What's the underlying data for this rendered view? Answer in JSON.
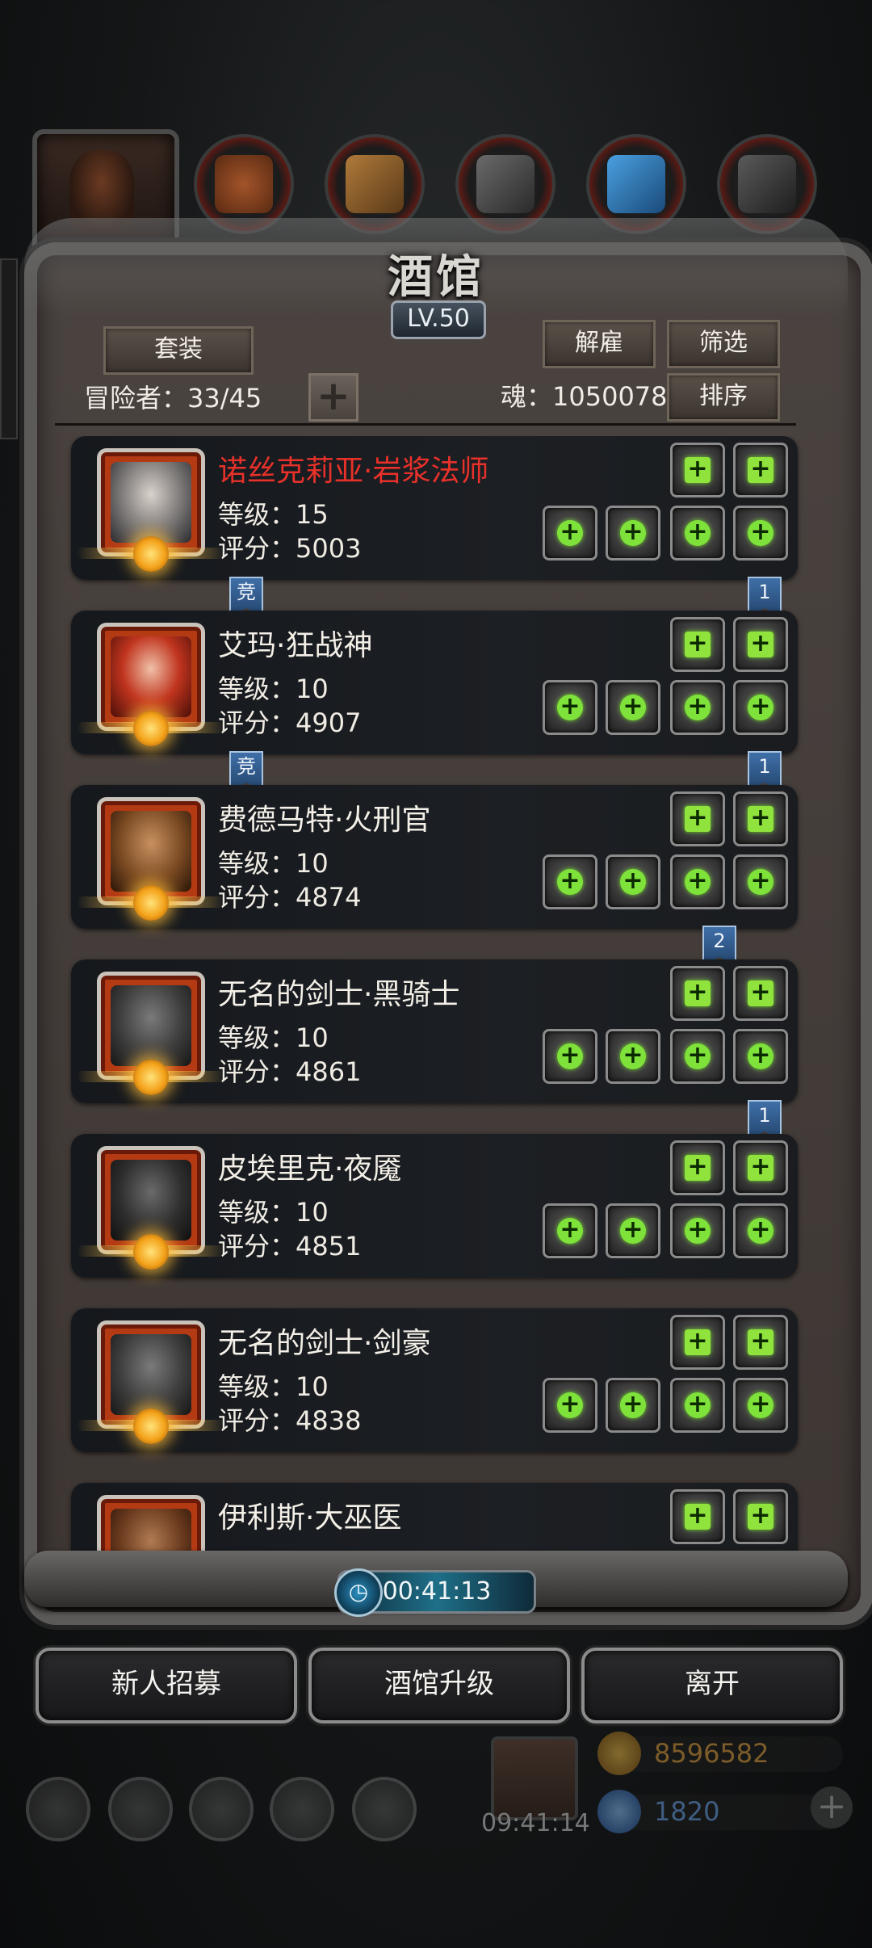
{
  "window": {
    "title": "酒馆",
    "level_badge": "LV.50"
  },
  "header": {
    "outfit_button": "套装",
    "dismiss_button": "解雇",
    "filter_button": "筛选",
    "sort_button": "排序",
    "adventurers_label": "冒险者：33/45",
    "add_capacity": "+",
    "soul_label": "魂：1050078"
  },
  "slot_icons": [
    "weapon-slot",
    "armor-slot",
    "accessory-slot",
    "ring-slot",
    "skill-slot-1",
    "skill-slot-2"
  ],
  "heroes": [
    {
      "name": "诺丝克莉亚·岩浆法师",
      "level": "等级：15",
      "score": "评分：5003",
      "name_color": "#e8312a",
      "badge_left": "竞",
      "badge_right": "1",
      "badge_left_shown": true,
      "badge_right_shown": true
    },
    {
      "name": "艾玛·狂战神",
      "level": "等级：10",
      "score": "评分：4907",
      "name_color": "#f4f0e8",
      "badge_left": "竞",
      "badge_right": "1",
      "badge_left_shown": true,
      "badge_right_shown": true
    },
    {
      "name": "费德马特·火刑官",
      "level": "等级：10",
      "score": "评分：4874",
      "name_color": "#f4f0e8",
      "badge_left": "",
      "badge_right": "2",
      "badge_left_shown": false,
      "badge_right_shown": true
    },
    {
      "name": "无名的剑士·黑骑士",
      "level": "等级：10",
      "score": "评分：4861",
      "name_color": "#f4f0e8",
      "badge_left": "",
      "badge_right": "1",
      "badge_left_shown": false,
      "badge_right_shown": true
    },
    {
      "name": "皮埃里克·夜魇",
      "level": "等级：10",
      "score": "评分：4851",
      "name_color": "#f4f0e8",
      "badge_left": "",
      "badge_right": "",
      "badge_left_shown": false,
      "badge_right_shown": false
    },
    {
      "name": "无名的剑士·剑豪",
      "level": "等级：10",
      "score": "评分：4838",
      "name_color": "#f4f0e8",
      "badge_left": "",
      "badge_right": "",
      "badge_left_shown": false,
      "badge_right_shown": false
    },
    {
      "name": "伊利斯·大巫医",
      "level": "",
      "score": "",
      "name_color": "#f4f0e8",
      "badge_left": "",
      "badge_right": "",
      "badge_left_shown": false,
      "badge_right_shown": false
    }
  ],
  "timer": {
    "value": "00:41:13"
  },
  "footer": {
    "recruit_button": "新人招募",
    "upgrade_button": "酒馆升级",
    "leave_button": "离开"
  },
  "background": {
    "gift_timer": "09:41:14",
    "gold": "8596582",
    "gems": "1820"
  },
  "colors": {
    "accent_green": "#7ee23a",
    "name_red": "#e8312a",
    "badge_blue": "#3f6fa8"
  }
}
